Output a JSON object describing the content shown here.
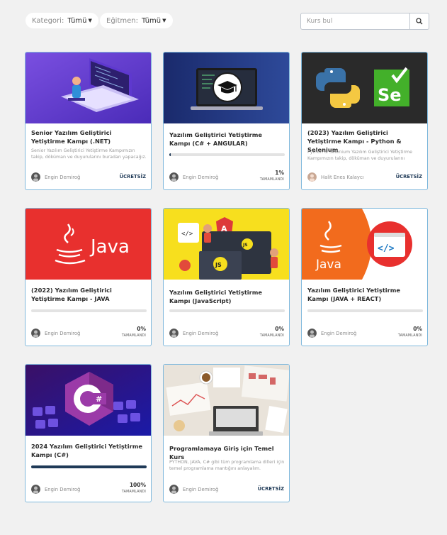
{
  "filters": {
    "category": {
      "label": "Kategori:",
      "value": "Tümü"
    },
    "instructor": {
      "label": "Eğitmen:",
      "value": "Tümü"
    }
  },
  "search": {
    "placeholder": "Kurs bul"
  },
  "progress_label": "TAMAMLANDI",
  "free_label": "ÜCRETSİZ",
  "courses": [
    {
      "title": "Senior Yazılım Geliştirici Yetiştirme Kampı (.NET)",
      "description": "Senior Yazılım Geliştirici Yetiştirme Kampımızın takip, döküman ve duyurularını buradan yapacağız.",
      "instructor": "Engin Demiroğ",
      "price": "ÜCRETSİZ",
      "thumbnail": "laptop-illustration"
    },
    {
      "title": "Yazılım Geliştirici Yetiştirme Kampı (C# + ANGULAR)",
      "instructor": "Engin Demiroğ",
      "progress_text": "1%",
      "progress": 0.01,
      "thumbnail": "graduation-cap-laptop"
    },
    {
      "title": "(2023) Yazılım Geliştirici Yetiştirme Kampı - Python & Selenium",
      "description": "Python & Selenium Yazılım Geliştirici Yetiştirme Kampımızın takip, döküman ve duyurularını buradan yapacağız.",
      "instructor": "Halit Enes Kalaycı",
      "price": "ÜCRETSİZ",
      "thumbnail": "python-selenium-logos"
    },
    {
      "title": "(2022) Yazılım Geliştirici Yetiştirme Kampı - JAVA",
      "instructor": "Engin Demiroğ",
      "progress_text": "0%",
      "progress": 0,
      "thumbnail": "java-logo"
    },
    {
      "title": "Yazılım Geliştirici Yetiştirme Kampı (JavaScript)",
      "instructor": "Engin Demiroğ",
      "progress_text": "0%",
      "progress": 0,
      "thumbnail": "javascript-illustration"
    },
    {
      "title": "Yazılım Geliştirici Yetiştirme Kampı (JAVA + REACT)",
      "instructor": "Engin Demiroğ",
      "progress_text": "0%",
      "progress": 0,
      "thumbnail": "java-react-logos"
    },
    {
      "title": "2024 Yazılım Geliştirici Yetiştirme Kampı (C#)",
      "instructor": "Engin Demiroğ",
      "progress_text": "100%",
      "progress": 1,
      "thumbnail": "csharp-keyboard"
    },
    {
      "title": "Programlamaya Giriş için Temel Kurs",
      "description": "PYTHON, JAVA, C# gibi tüm programlama dilleri için temel programlama mantığını anlayalım.",
      "instructor": "Engin Demiroğ",
      "price": "ÜCRETSİZ",
      "thumbnail": "desk-photo"
    }
  ],
  "colors": {
    "background": "#f1f1f1",
    "card_border": "#7fb8dc",
    "accent": "#1f3a57",
    "java_red": "#e8302e",
    "js_yellow": "#f7df1e"
  }
}
